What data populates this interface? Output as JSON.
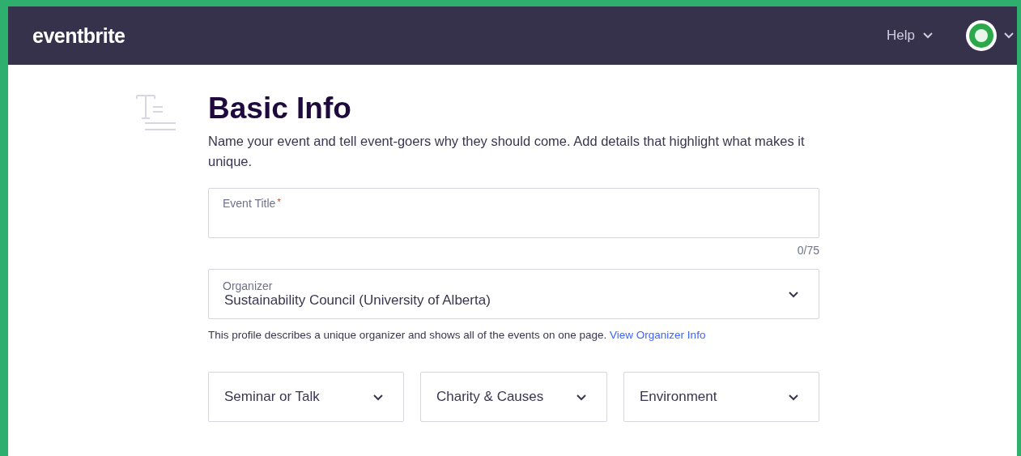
{
  "header": {
    "logo": "eventbrite",
    "help": "Help"
  },
  "page": {
    "title": "Basic Info",
    "description": "Name your event and tell event-goers why they should come. Add details that highlight what makes it unique."
  },
  "event_title": {
    "label": "Event Title",
    "required_mark": "*",
    "counter": "0/75"
  },
  "organizer": {
    "label": "Organizer",
    "value": "Sustainability Council (University of Alberta)",
    "hint": "This profile describes a unique organizer and shows all of the events on one page.",
    "link": "View Organizer Info"
  },
  "selects": [
    {
      "value": "Seminar or Talk"
    },
    {
      "value": "Charity & Causes"
    },
    {
      "value": "Environment"
    }
  ]
}
